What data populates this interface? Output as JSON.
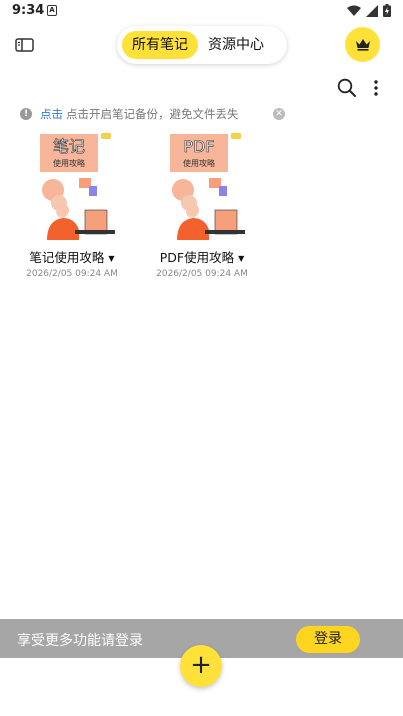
{
  "status_bar": {
    "time": "9:34",
    "notification_letter": "A",
    "icons": [
      "wifi-icon",
      "signal-icon",
      "battery-charging-icon"
    ]
  },
  "header": {
    "icon": "sidebar-toggle-icon",
    "tabs": [
      {
        "label": "所有笔记",
        "active": true
      },
      {
        "label": "资源中心",
        "active": false
      }
    ],
    "vip_icon": "crown-icon"
  },
  "toolbar": {
    "icons": [
      "search-icon",
      "more-vertical-icon"
    ]
  },
  "backup_notice": {
    "link": "点击",
    "text": "点击开启笔记备份，避免文件丢失"
  },
  "notes": [
    {
      "title": "笔记使用攻略",
      "date": "2026/2/05 09:24 AM",
      "cover_lines": [
        "笔记",
        "使用攻略"
      ]
    },
    {
      "title": "PDF使用攻略",
      "date": "2026/2/05 09:24 AM",
      "cover_lines": [
        "PDF",
        "使用攻略"
      ]
    }
  ],
  "login_banner": {
    "text": "享受更多功能请登录",
    "button": "登录"
  },
  "fab": {
    "label": "+"
  },
  "colors": {
    "accent": "#ffe13a",
    "banner": "#a6a6a6",
    "link": "#2a7fd8"
  }
}
